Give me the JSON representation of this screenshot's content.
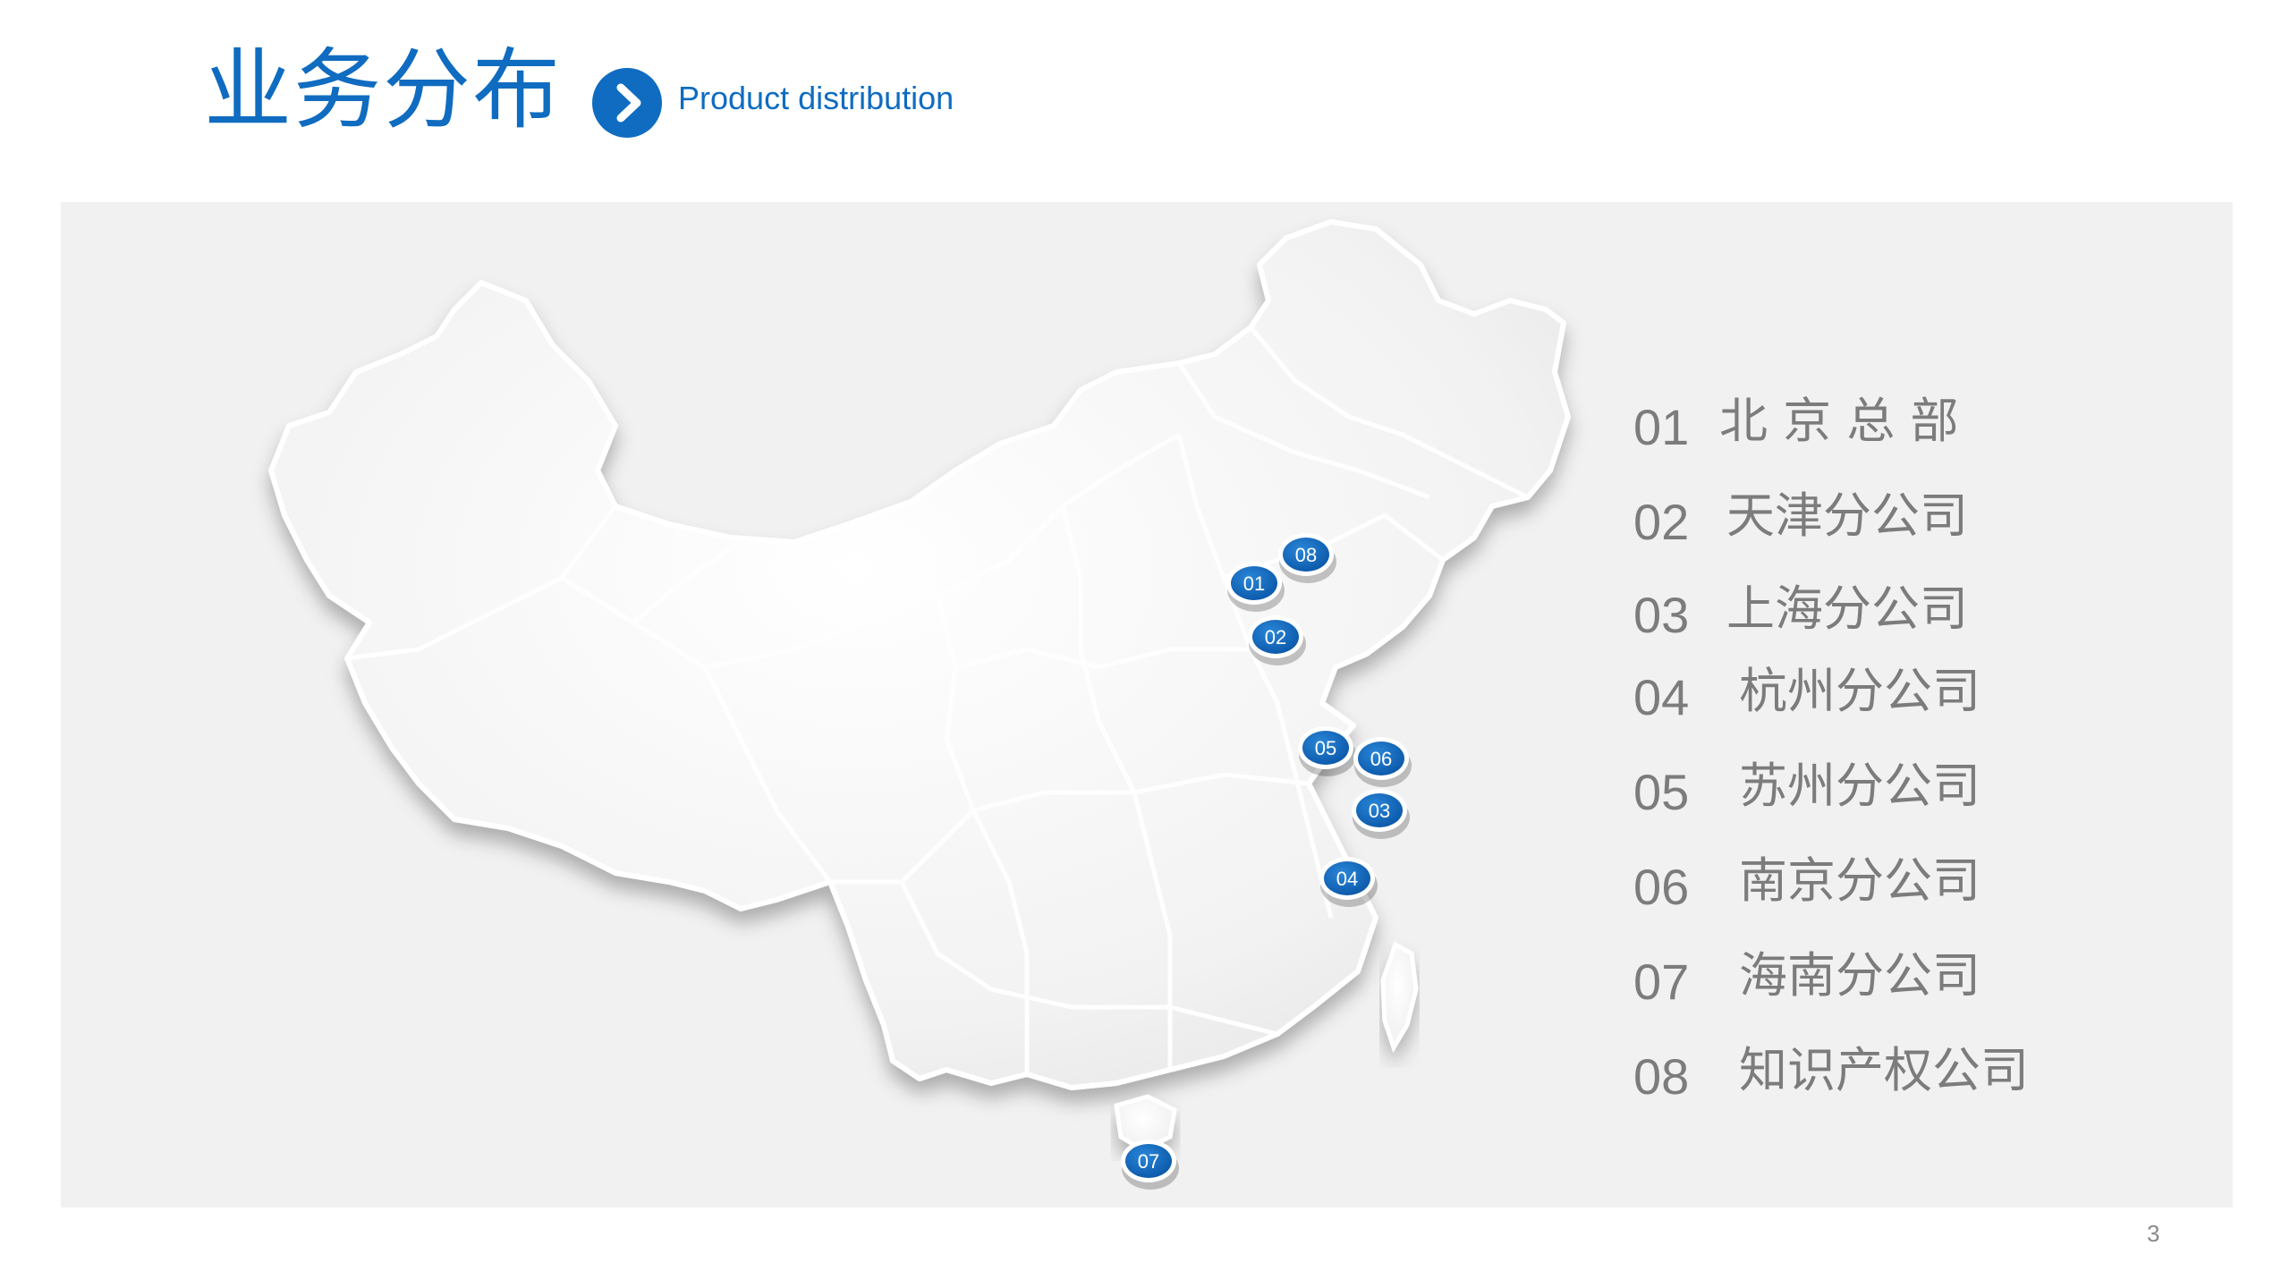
{
  "header": {
    "title": "业务分布",
    "subtitle": "Product distribution",
    "icon": "chevron-right-circle-icon"
  },
  "colors": {
    "accent": "#0f6cc0",
    "panel": "#f1f1f1",
    "legend_text": "#7c7c7c"
  },
  "map": {
    "markers": [
      {
        "id": "01",
        "label": "01"
      },
      {
        "id": "02",
        "label": "02"
      },
      {
        "id": "03",
        "label": "03"
      },
      {
        "id": "04",
        "label": "04"
      },
      {
        "id": "05",
        "label": "05"
      },
      {
        "id": "06",
        "label": "06"
      },
      {
        "id": "07",
        "label": "07"
      },
      {
        "id": "08",
        "label": "08"
      }
    ]
  },
  "legend": {
    "items": [
      {
        "num": "01",
        "name": "北 京 总 部"
      },
      {
        "num": "02",
        "name": "天津分公司"
      },
      {
        "num": "03",
        "name": "上海分公司"
      },
      {
        "num": "04",
        "name": "杭州分公司"
      },
      {
        "num": "05",
        "name": "苏州分公司"
      },
      {
        "num": "06",
        "name": "南京分公司"
      },
      {
        "num": "07",
        "name": "海南分公司"
      },
      {
        "num": "08",
        "name": "知识产权公司"
      }
    ]
  },
  "page_number": "3"
}
